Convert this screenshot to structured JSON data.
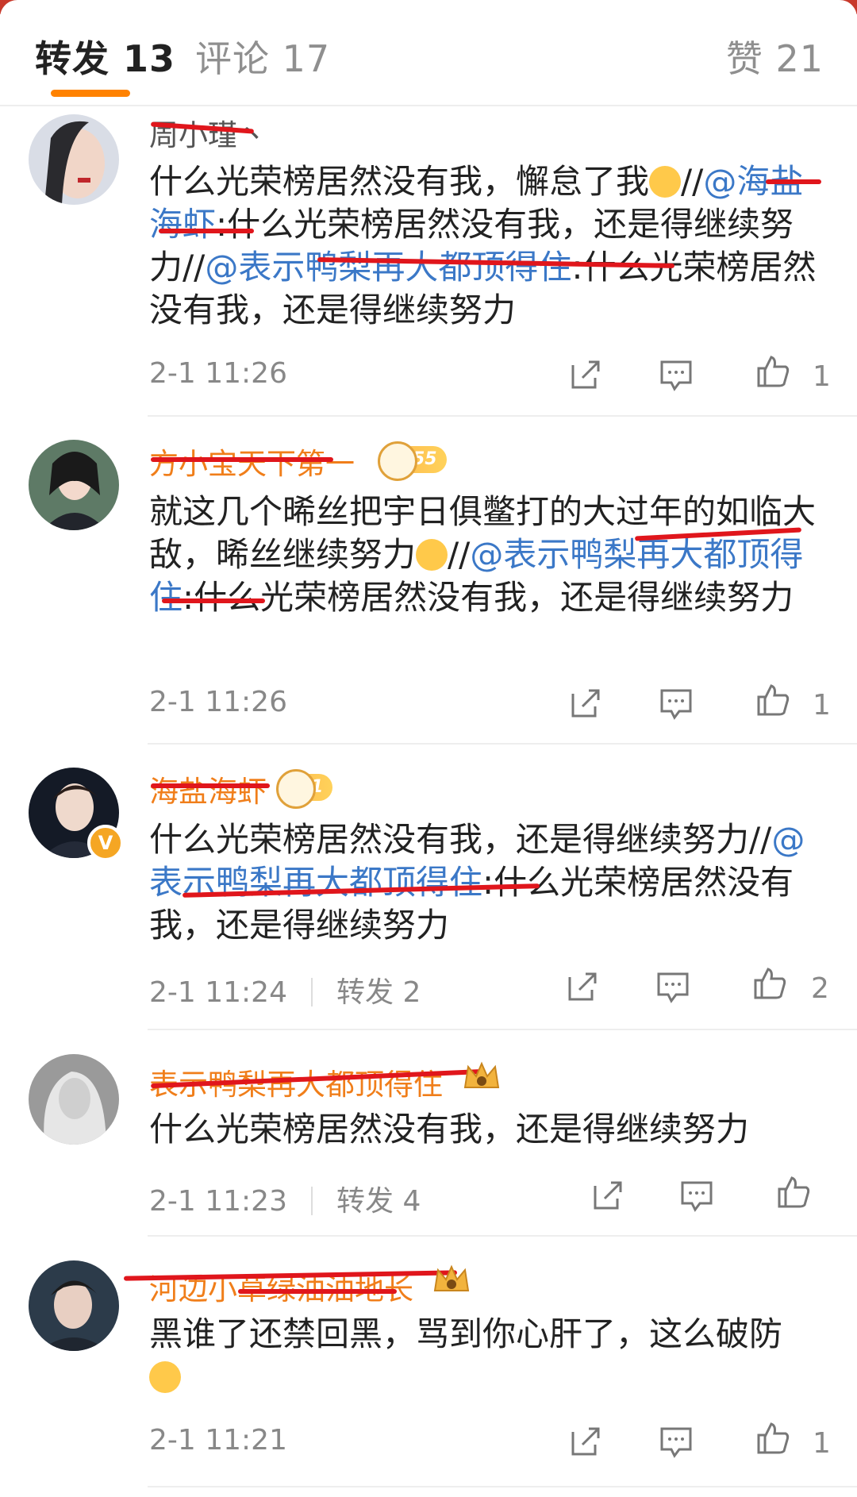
{
  "tabs": {
    "repost": "转发 13",
    "comment": "评论 17",
    "like": "赞 21"
  },
  "posts": [
    {
      "user": "周小瑾丶",
      "text_before": "什么光荣榜居然没有我，懈怠了我",
      "text_mid1": "//",
      "mention1": "@海盐海虾",
      "text_mid2": ":什么光荣榜居然没有我，还是得继续努力//",
      "mention2": "@表示鸭梨再大都顶得住",
      "text_after": ":什么光荣榜居然没有我，还是得继续努力",
      "time": "2-1 11:26",
      "likes": "1"
    },
    {
      "user": "方小宝天下第一",
      "level": "55",
      "text_before": "就这几个晞丝把宇日俱鳖打的大过年的如临大敌，晞丝继续努力",
      "text_mid": "//",
      "mention": "@表示鸭梨再大都顶得住",
      "text_after": ":什么光荣榜居然没有我，还是得继续努力",
      "time": "2-1 11:26",
      "likes": "1"
    },
    {
      "user": "海盐海虾",
      "level": "1",
      "badge": "V",
      "text_before": "什么光荣榜居然没有我，还是得继续努力//",
      "mention": "@表示鸭梨再大都顶得住",
      "text_after": ":什么光荣榜居然没有我，还是得继续努力",
      "time": "2-1 11:24",
      "reposts": "转发 2",
      "likes": "2"
    },
    {
      "user": "表示鸭梨再大都顶得住",
      "text": "什么光荣榜居然没有我，还是得继续努力",
      "time": "2-1 11:23",
      "reposts": "转发 4"
    },
    {
      "user": "河边小草绿油油地长",
      "text": "黑谁了还禁回黑，骂到你心肝了，这么破防",
      "time": "2-1 11:21",
      "likes": "1"
    }
  ],
  "colors": {
    "accent": "#ff8200",
    "mention": "#3b78c7",
    "username_orange": "#f07e1a",
    "redaction": "#e0161c"
  },
  "icons": [
    "share-icon",
    "comment-icon",
    "thumbs-up-icon",
    "crown-icon",
    "level-badge-icon"
  ]
}
